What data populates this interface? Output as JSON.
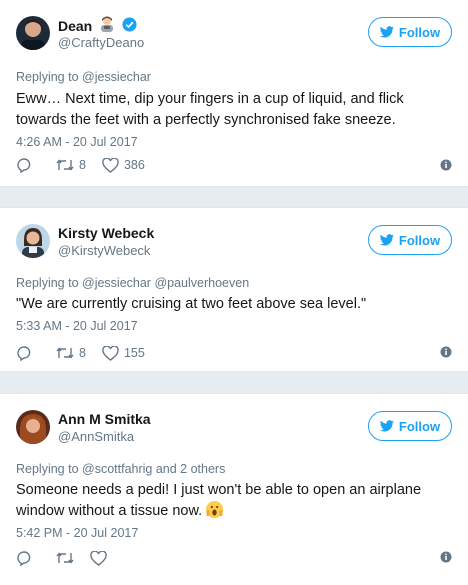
{
  "tweets": [
    {
      "name": "Dean",
      "handle": "@CraftyDeano",
      "follow": "Follow",
      "reply_to": "Replying to @jessiechar",
      "text": "Eww… Next time, dip your fingers in a cup of liquid, and flick towards the feet with a perfectly synchronised fake sneeze.",
      "time": "4:26 AM - 20 Jul 2017",
      "retweets": "8",
      "likes": "386",
      "verified": true
    },
    {
      "name": "Kirsty Webeck",
      "handle": "@KirstyWebeck",
      "follow": "Follow",
      "reply_to": "Replying to @jessiechar @paulverhoeven",
      "text": "\"We are currently cruising at two feet above sea level.\"",
      "time": "5:33 AM - 20 Jul 2017",
      "retweets": "8",
      "likes": "155"
    },
    {
      "name": "Ann M Smitka",
      "handle": "@AnnSmitka",
      "follow": "Follow",
      "reply_to": "Replying to @scottfahrig and 2 others",
      "text": "Someone needs a pedi! I just won't be able to open an airplane window without a tissue now.",
      "time": "5:42 PM - 20 Jul 2017",
      "retweets": "",
      "likes": ""
    }
  ],
  "colors": {
    "accent": "#1da1f2",
    "muted": "#657786",
    "background": "#e6ecf0"
  }
}
